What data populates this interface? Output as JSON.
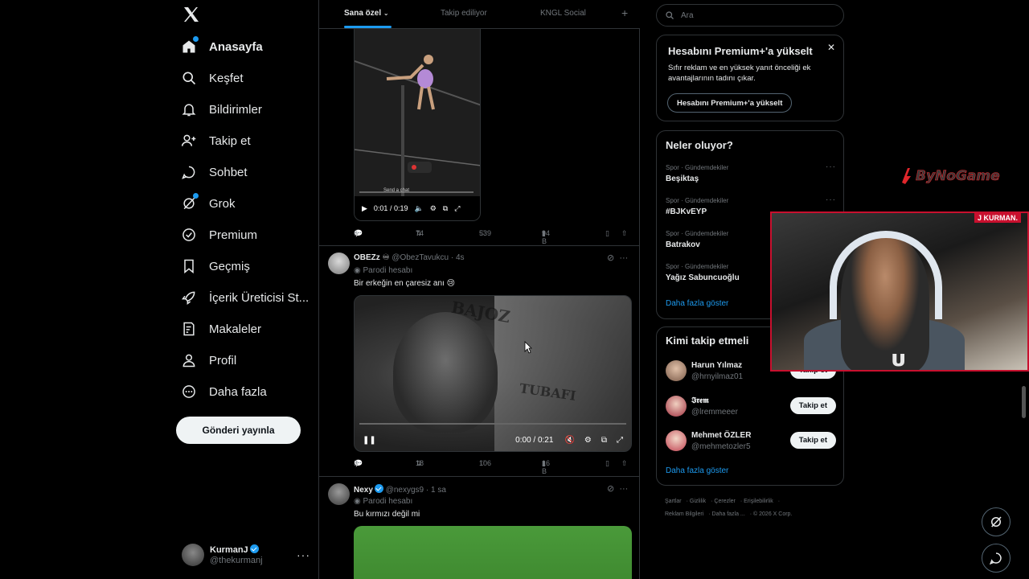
{
  "nav": {
    "items": [
      {
        "label": "Anasayfa",
        "icon": "home-icon",
        "active": true,
        "dot": true
      },
      {
        "label": "Keşfet",
        "icon": "search-icon"
      },
      {
        "label": "Bildirimler",
        "icon": "bell-icon"
      },
      {
        "label": "Takip et",
        "icon": "follow-icon"
      },
      {
        "label": "Sohbet",
        "icon": "chat-icon"
      },
      {
        "label": "Grok",
        "icon": "grok-icon",
        "dot": true
      },
      {
        "label": "Premium",
        "icon": "premium-icon"
      },
      {
        "label": "Geçmiş",
        "icon": "bookmark-icon"
      },
      {
        "label": "İçerik Üreticisi St...",
        "icon": "rocket-icon"
      },
      {
        "label": "Makaleler",
        "icon": "articles-icon"
      },
      {
        "label": "Profil",
        "icon": "profile-icon"
      },
      {
        "label": "Daha fazla",
        "icon": "more-circle-icon"
      }
    ],
    "post_button": "Gönderi yayınla",
    "account": {
      "name": "KurmanJ",
      "handle": "@thekurmanj"
    }
  },
  "tabs": {
    "items": [
      "Sana özel",
      "Takip ediliyor",
      "KNGL Social"
    ],
    "active": "Sana özel"
  },
  "feed": {
    "post1": {
      "video_caption": "Send a chat",
      "time": "0:01 / 0:19",
      "stats": {
        "replies": "6",
        "reposts": "74",
        "likes": "539",
        "views": "94 B"
      }
    },
    "post2": {
      "name": "OBEZz",
      "name_suffix": "♾",
      "handle": "@ObezTavukcu",
      "time": "· 4s",
      "parody": "Parodi hesabı",
      "text": "Bir erkeğin en çaresiz anı 😢",
      "video_text_top": "BAJOZ",
      "video_text_bottom": "TUBAFI",
      "video_time": "0:00 / 0:21",
      "stats": {
        "replies": "3",
        "reposts": "18",
        "likes": "106",
        "views": "16 B"
      }
    },
    "post3": {
      "name": "Nexy",
      "handle": "@nexygs9",
      "time": "· 1 sa",
      "parody": "Parodi hesabı",
      "text": "Bu kırmızı değil mi"
    }
  },
  "right": {
    "search_placeholder": "Ara",
    "premium": {
      "title": "Hesabını Premium+'a yükselt",
      "body": "Sıfır reklam ve en yüksek yanıt önceliği ek avantajlarının tadını çıkar.",
      "button": "Hesabını Premium+'a yükselt"
    },
    "trends": {
      "title": "Neler oluyor?",
      "items": [
        {
          "category": "Spor · Gündemdekiler",
          "name": "Beşiktaş"
        },
        {
          "category": "Spor · Gündemdekiler",
          "name": "#BJKvEYP"
        },
        {
          "category": "Spor · Gündemdekiler",
          "name": "Batrakov"
        },
        {
          "category": "Spor · Gündemdekiler",
          "name": "Yağız Sabuncuoğlu"
        }
      ],
      "show_more": "Daha fazla göster"
    },
    "who_to_follow": {
      "title": "Kimi takip etmeli",
      "items": [
        {
          "name": "Harun Yılmaz",
          "handle": "@hrnyilmaz01",
          "button": "Takip et"
        },
        {
          "name": "𝕴𝖗𝖊𝖒",
          "handle": "@lremmeeer",
          "button": "Takip et"
        },
        {
          "name": "Mehmet ÖZLER",
          "handle": "@mehmetozler5",
          "button": "Takip et"
        }
      ],
      "show_more": "Daha fazla göster"
    },
    "footer": {
      "links": [
        "Şartlar",
        "Gizlilik",
        "Çerezler",
        "Erişilebilirlik",
        "Reklam Bilgileri",
        "Daha fazla ..."
      ],
      "copyright": "© 2026 X Corp."
    }
  },
  "overlay": {
    "webcam_label": "J KURMAN.",
    "brand_logo": "ByNoGame"
  },
  "colors": {
    "accent": "#1d9bf0",
    "background": "#000000",
    "webcam_border": "#c8102e"
  }
}
